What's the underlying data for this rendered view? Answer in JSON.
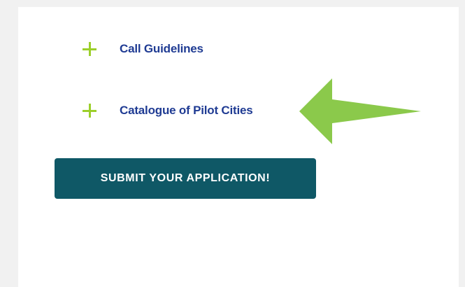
{
  "accordion": {
    "items": [
      {
        "label": "Call Guidelines",
        "icon": "plus-icon"
      },
      {
        "label": "Catalogue of Pilot Cities",
        "icon": "plus-icon"
      }
    ]
  },
  "annotation": {
    "icon": "arrow-left-icon",
    "color": "#8bc94b"
  },
  "cta": {
    "submit_label": "SUBMIT YOUR APPLICATION!"
  },
  "colors": {
    "accent_green": "#9ccf2b",
    "link_blue": "#1f3b93",
    "button_teal": "#0f5866",
    "page_background": "#f1f1f1",
    "panel_background": "#ffffff"
  }
}
